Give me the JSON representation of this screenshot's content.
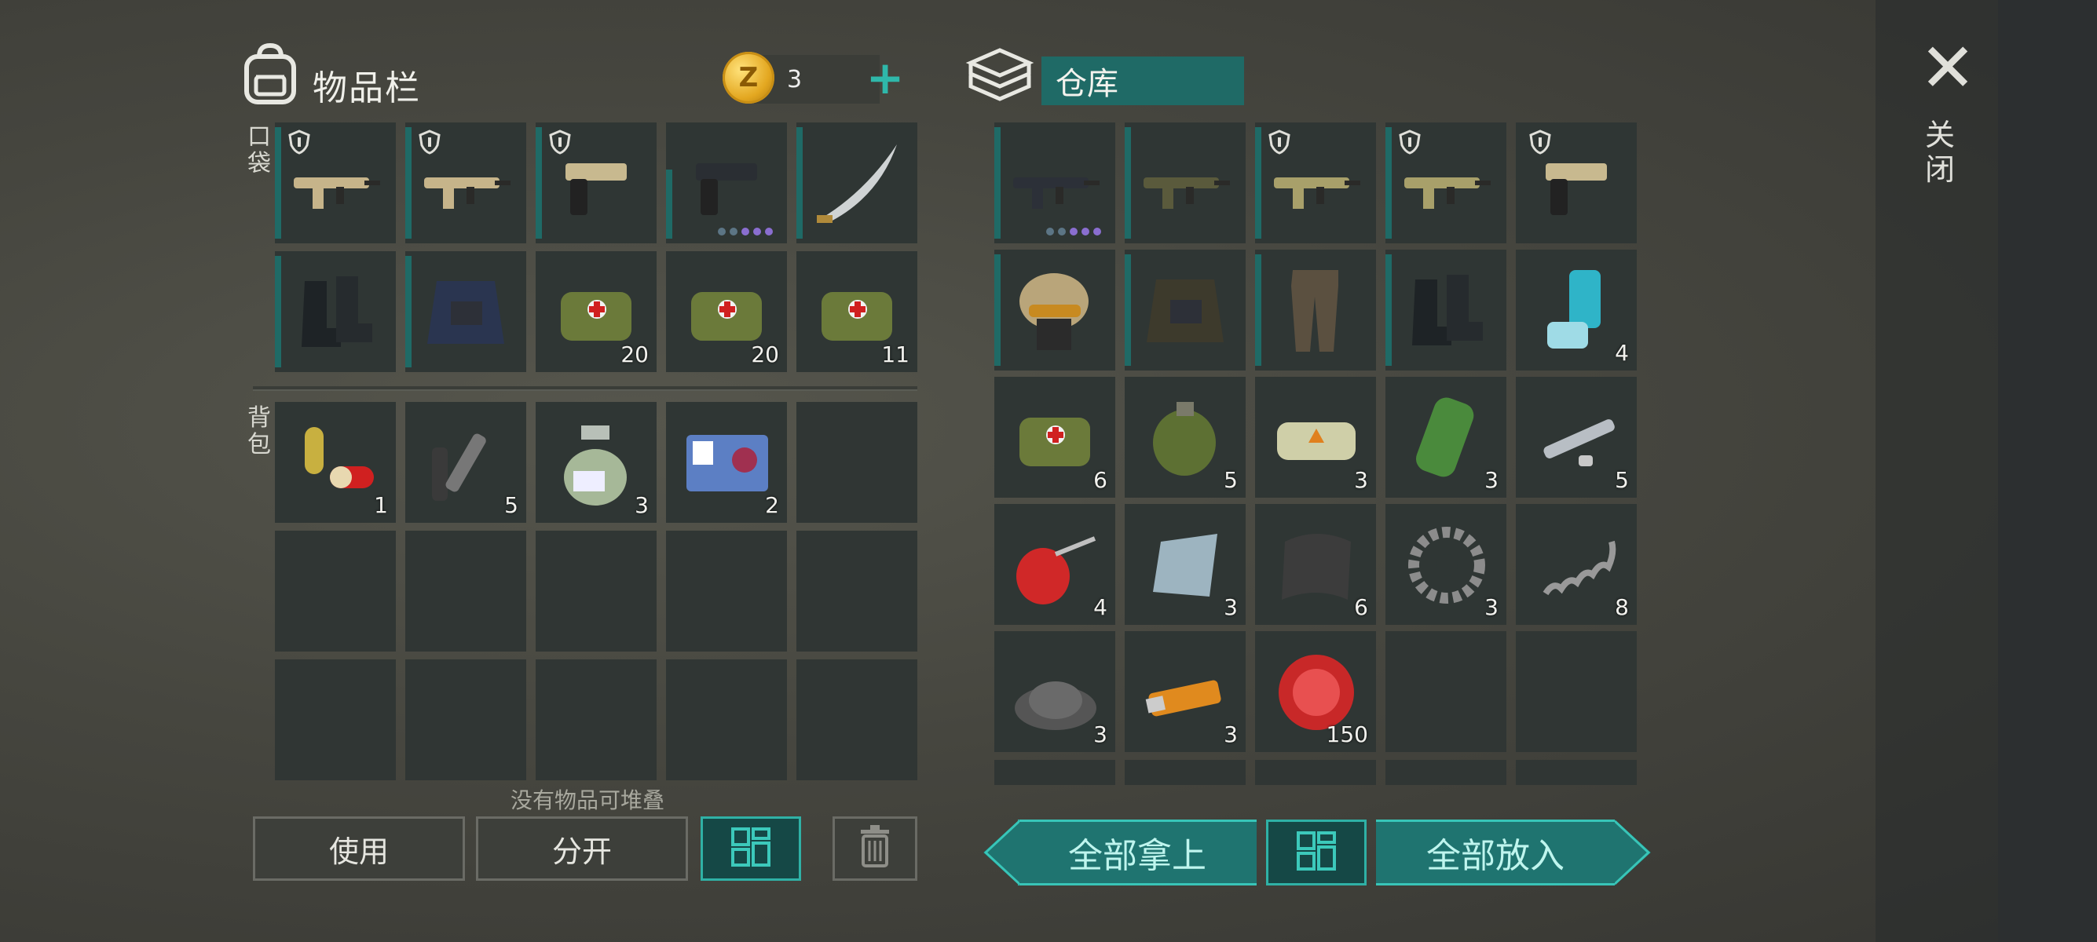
{
  "inventory": {
    "title": "物品栏",
    "icon": "backpack-icon",
    "currency": {
      "icon": "coin-icon",
      "symbol": "Z",
      "count": "3",
      "add_icon": "plus-icon"
    },
    "pocket_label": "口袋",
    "backpack_label": "背包",
    "pocket_slots": [
      {
        "item": "tan-assault-rifle",
        "shield": true,
        "bar": "full",
        "count": ""
      },
      {
        "item": "tan-assault-rifle",
        "shield": true,
        "bar": "full",
        "count": ""
      },
      {
        "item": "desert-pistol",
        "shield": true,
        "bar": "full",
        "count": ""
      },
      {
        "item": "black-pistol",
        "shield": false,
        "bar": "half",
        "count": "",
        "quality_dots": 5
      },
      {
        "item": "katana",
        "shield": false,
        "bar": "full",
        "count": ""
      },
      {
        "item": "combat-boots",
        "shield": false,
        "bar": "full",
        "count": ""
      },
      {
        "item": "tactical-vest",
        "shield": false,
        "bar": "full",
        "count": ""
      },
      {
        "item": "medkit-bag",
        "shield": false,
        "bar": "none",
        "count": "20"
      },
      {
        "item": "medkit-bag",
        "shield": false,
        "bar": "none",
        "count": "20"
      },
      {
        "item": "medkit-bag",
        "shield": false,
        "bar": "none",
        "count": "11"
      }
    ],
    "backpack_slots": [
      {
        "item": "capsule-pill",
        "count": "1"
      },
      {
        "item": "metal-pipe",
        "count": "5"
      },
      {
        "item": "chemical-bottle",
        "count": "3"
      },
      {
        "item": "biohazard-keycard",
        "count": "2"
      },
      {
        "item": "",
        "count": ""
      },
      {
        "item": "",
        "count": ""
      },
      {
        "item": "",
        "count": ""
      },
      {
        "item": "",
        "count": ""
      },
      {
        "item": "",
        "count": ""
      },
      {
        "item": "",
        "count": ""
      },
      {
        "item": "",
        "count": ""
      },
      {
        "item": "",
        "count": ""
      },
      {
        "item": "",
        "count": ""
      },
      {
        "item": "",
        "count": ""
      },
      {
        "item": "",
        "count": ""
      }
    ],
    "hint": "没有物品可堆叠",
    "buttons": {
      "use": "使用",
      "split": "分开",
      "sort_icon": "grid-sort-icon",
      "trash_icon": "trash-icon"
    }
  },
  "storage": {
    "title": "仓库",
    "icon": "storage-boxes-icon",
    "slots": [
      {
        "item": "assault-rifle",
        "shield": false,
        "bar": "full",
        "count": "",
        "quality_dots": 5
      },
      {
        "item": "grenade-launcher-rifle",
        "shield": false,
        "bar": "full",
        "count": ""
      },
      {
        "item": "tan-sniper-rifle",
        "shield": true,
        "bar": "full",
        "count": ""
      },
      {
        "item": "tan-sniper-rifle",
        "shield": true,
        "bar": "full",
        "count": ""
      },
      {
        "item": "desert-pistol",
        "shield": true,
        "bar": "none",
        "count": ""
      },
      {
        "item": "tactical-helmet",
        "shield": false,
        "bar": "full",
        "count": ""
      },
      {
        "item": "tactical-jacket",
        "shield": false,
        "bar": "full",
        "count": ""
      },
      {
        "item": "camo-pants",
        "shield": false,
        "bar": "full",
        "count": ""
      },
      {
        "item": "leather-boots",
        "shield": false,
        "bar": "full",
        "count": ""
      },
      {
        "item": "inhaler",
        "shield": false,
        "bar": "none",
        "count": "4"
      },
      {
        "item": "medkit-bag",
        "shield": false,
        "bar": "none",
        "count": "6"
      },
      {
        "item": "hand-grenade",
        "shield": false,
        "bar": "none",
        "count": "5"
      },
      {
        "item": "explosive-brick",
        "shield": false,
        "bar": "none",
        "count": "3"
      },
      {
        "item": "toxic-canister",
        "shield": false,
        "bar": "none",
        "count": "3"
      },
      {
        "item": "gun-parts",
        "shield": false,
        "bar": "none",
        "count": "5"
      },
      {
        "item": "oil-can",
        "shield": false,
        "bar": "none",
        "count": "4"
      },
      {
        "item": "metal-plate",
        "shield": false,
        "bar": "none",
        "count": "3"
      },
      {
        "item": "carbon-fiber",
        "shield": false,
        "bar": "none",
        "count": "6"
      },
      {
        "item": "gear",
        "shield": false,
        "bar": "none",
        "count": "3"
      },
      {
        "item": "spring",
        "shield": false,
        "bar": "none",
        "count": "8"
      },
      {
        "item": "gravel",
        "shield": false,
        "bar": "none",
        "count": "3"
      },
      {
        "item": "usb-drive",
        "shield": false,
        "bar": "none",
        "count": "3"
      },
      {
        "item": "bottle-cap",
        "shield": false,
        "bar": "none",
        "count": "150"
      },
      {
        "item": "",
        "shield": false,
        "bar": "none",
        "count": ""
      },
      {
        "item": "",
        "shield": false,
        "bar": "none",
        "count": ""
      }
    ],
    "buttons": {
      "take_all": "全部拿上",
      "sort_icon": "grid-sort-icon",
      "put_all": "全部放入"
    }
  },
  "close": {
    "icon": "close-icon",
    "label": "关闭"
  },
  "colors": {
    "accent": "#1f6a66",
    "accent_bright": "#2fb1a6",
    "slot_bg": "#2f3634"
  }
}
